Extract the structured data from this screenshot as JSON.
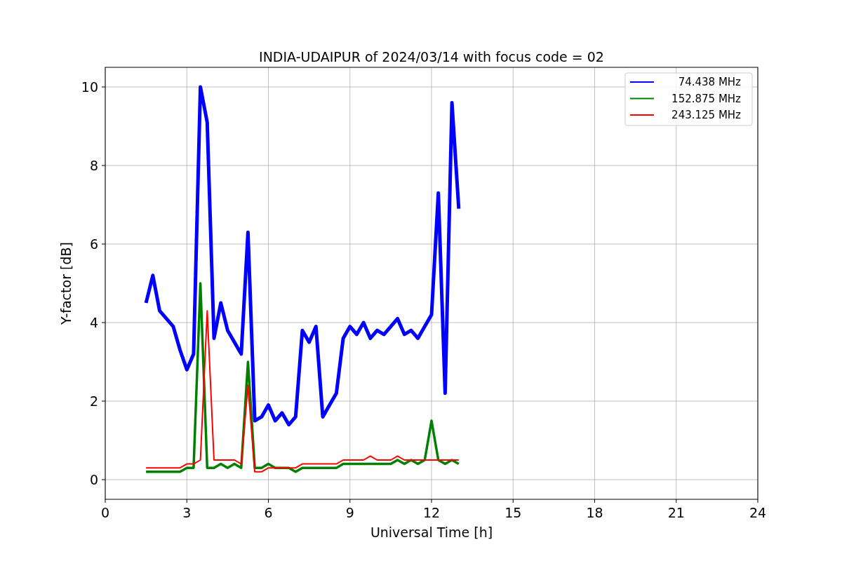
{
  "chart_data": {
    "type": "line",
    "title": "INDIA-UDAIPUR of 2024/03/14 with focus code = 02",
    "xlabel": "Universal Time [h]",
    "ylabel": "Y-factor [dB]",
    "x": [
      1.5,
      1.75,
      2.0,
      2.25,
      2.5,
      2.75,
      3.0,
      3.25,
      3.5,
      3.75,
      4.0,
      4.25,
      4.5,
      4.75,
      5.0,
      5.25,
      5.5,
      5.75,
      6.0,
      6.25,
      6.5,
      6.75,
      7.0,
      7.25,
      7.5,
      7.75,
      8.0,
      8.25,
      8.5,
      8.75,
      9.0,
      9.25,
      9.5,
      9.75,
      10.0,
      10.25,
      10.5,
      10.75,
      11.0,
      11.25,
      11.5,
      11.75,
      12.0,
      12.25,
      12.5,
      12.75,
      13.0
    ],
    "series": [
      {
        "name": "74.438 MHz",
        "color": "#0000ff",
        "values": [
          4.5,
          5.2,
          4.3,
          4.1,
          3.9,
          3.3,
          2.8,
          3.2,
          10.0,
          9.1,
          3.6,
          4.5,
          3.8,
          3.5,
          3.2,
          6.3,
          1.5,
          1.6,
          1.9,
          1.5,
          1.7,
          1.4,
          1.6,
          3.8,
          3.5,
          3.9,
          1.6,
          1.9,
          2.2,
          3.6,
          3.9,
          3.7,
          4.0,
          3.6,
          3.8,
          3.7,
          3.9,
          4.1,
          3.7,
          3.8,
          3.6,
          3.9,
          4.2,
          7.3,
          2.2,
          9.6,
          6.9
        ]
      },
      {
        "name": "152.875 MHz",
        "color": "#008000",
        "values": [
          0.2,
          0.2,
          0.2,
          0.2,
          0.2,
          0.2,
          0.3,
          0.3,
          5.0,
          0.3,
          0.3,
          0.4,
          0.3,
          0.4,
          0.3,
          3.0,
          0.3,
          0.3,
          0.4,
          0.3,
          0.3,
          0.3,
          0.2,
          0.3,
          0.3,
          0.3,
          0.3,
          0.3,
          0.3,
          0.4,
          0.4,
          0.4,
          0.4,
          0.4,
          0.4,
          0.4,
          0.4,
          0.5,
          0.4,
          0.5,
          0.4,
          0.5,
          1.5,
          0.5,
          0.4,
          0.5,
          0.4
        ]
      },
      {
        "name": "243.125 MHz",
        "color": "#ff0000",
        "values": [
          0.3,
          0.3,
          0.3,
          0.3,
          0.3,
          0.3,
          0.4,
          0.4,
          0.5,
          4.3,
          0.5,
          0.5,
          0.5,
          0.5,
          0.4,
          2.4,
          0.2,
          0.2,
          0.3,
          0.3,
          0.3,
          0.3,
          0.3,
          0.4,
          0.4,
          0.4,
          0.4,
          0.4,
          0.4,
          0.5,
          0.5,
          0.5,
          0.5,
          0.6,
          0.5,
          0.5,
          0.5,
          0.6,
          0.5,
          0.5,
          0.5,
          0.5,
          0.5,
          0.5,
          0.5,
          0.5,
          0.5
        ]
      }
    ],
    "xlim": [
      0,
      24
    ],
    "ylim": [
      -0.5,
      10.5
    ],
    "xticks": [
      0,
      3,
      6,
      9,
      12,
      15,
      18,
      21,
      24
    ],
    "yticks": [
      0,
      2,
      4,
      6,
      8,
      10
    ],
    "grid": true,
    "legend": true
  }
}
